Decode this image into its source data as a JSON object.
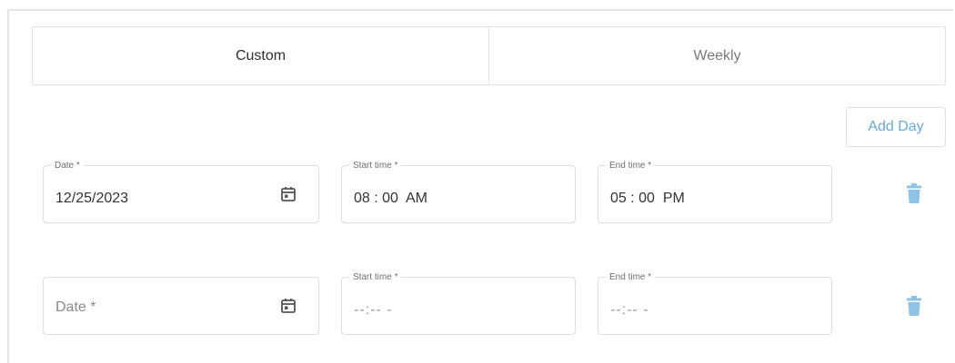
{
  "tabs": [
    {
      "label": "Custom",
      "active": true
    },
    {
      "label": "Weekly",
      "active": false
    }
  ],
  "add_day_label": "Add Day",
  "rows": [
    {
      "date": {
        "label": "Date *",
        "value": "12/25/2023"
      },
      "start": {
        "label": "Start time *",
        "value": "08 : 00  AM"
      },
      "end": {
        "label": "End time *",
        "value": "05 : 00  PM"
      },
      "delete_icon": "trash-icon"
    },
    {
      "date": {
        "placeholder": "Date *"
      },
      "start": {
        "label": "Start time *",
        "value": "--:-- -"
      },
      "end": {
        "label": "End time *",
        "value": "--:-- -"
      },
      "delete_icon": "trash-icon"
    }
  ],
  "colors": {
    "accent": "#6aa9d8",
    "trash": "#8fc3e6",
    "border": "#dedede"
  }
}
